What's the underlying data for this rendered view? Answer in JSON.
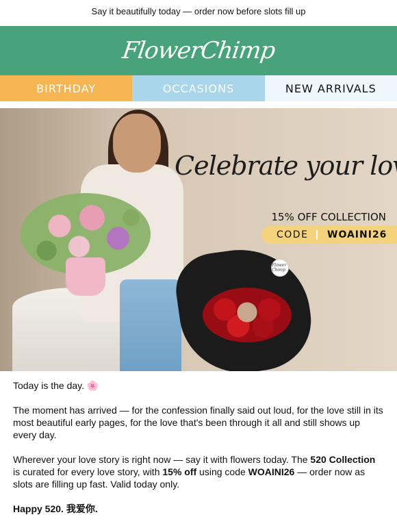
{
  "preheader": "Say it beautifully today — order now before slots fill up",
  "brand": {
    "logo_text": "FlowerChimp",
    "bar_color": "#48a37a"
  },
  "nav": {
    "birthday": "BIRTHDAY",
    "occasions": "OCCASIONS",
    "new_arrivals": "NEW ARRIVALS",
    "colors": {
      "birthday": "#f5b553",
      "occasions": "#a9d6ea",
      "new_arrivals": "#eef8fc"
    }
  },
  "hero": {
    "headline": "Celebrate your love",
    "offer": "15% OFF COLLECTION",
    "code_label": "CODE",
    "code_value": "WOAINI26",
    "tag_text": "Flower Chimp"
  },
  "content": {
    "intro": "Today is the day. 🌸",
    "p1": "The moment has arrived — for the confession finally said out loud, for the love still in its most beautiful early pages, for the love that's been through it all and still shows up every day.",
    "p2_a": "Wherever your love story is right now — say it with flowers today. The ",
    "p2_b": "520 Collection",
    "p2_c": " is curated for every love story, with ",
    "p2_d": "15% off",
    "p2_e": " using code ",
    "p2_f": "WOAINI26",
    "p2_g": " — order now as slots are filling up fast. Valid today only.",
    "signoff": "Happy 520. 我爱你."
  }
}
